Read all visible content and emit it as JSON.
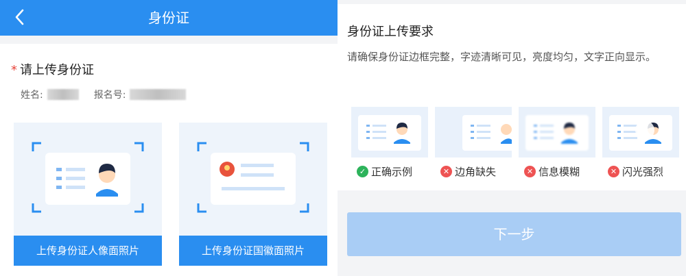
{
  "header": {
    "title": "身份证",
    "back_icon": "chevron-left-icon"
  },
  "form": {
    "required_mark": "*",
    "title": "请上传身份证",
    "name_label": "姓名:",
    "reg_no_label": "报名号:",
    "upload_front_label": "上传身份证人像面照片",
    "upload_back_label": "上传身份证国徽面照片"
  },
  "requirements": {
    "title": "身份证上传要求",
    "description": "请确保身份证边框完整，字迹清晰可见，亮度均匀，文字正向显示。",
    "samples": [
      {
        "label": "正确示例",
        "status": "ok"
      },
      {
        "label": "边角缺失",
        "status": "bad"
      },
      {
        "label": "信息模糊",
        "status": "bad"
      },
      {
        "label": "闪光强烈",
        "status": "bad"
      }
    ],
    "next_label": "下一步"
  },
  "colors": {
    "primary": "#2a8ef0",
    "ok": "#2db35b",
    "error": "#ee5353",
    "disabled": "#a9cdf5"
  }
}
